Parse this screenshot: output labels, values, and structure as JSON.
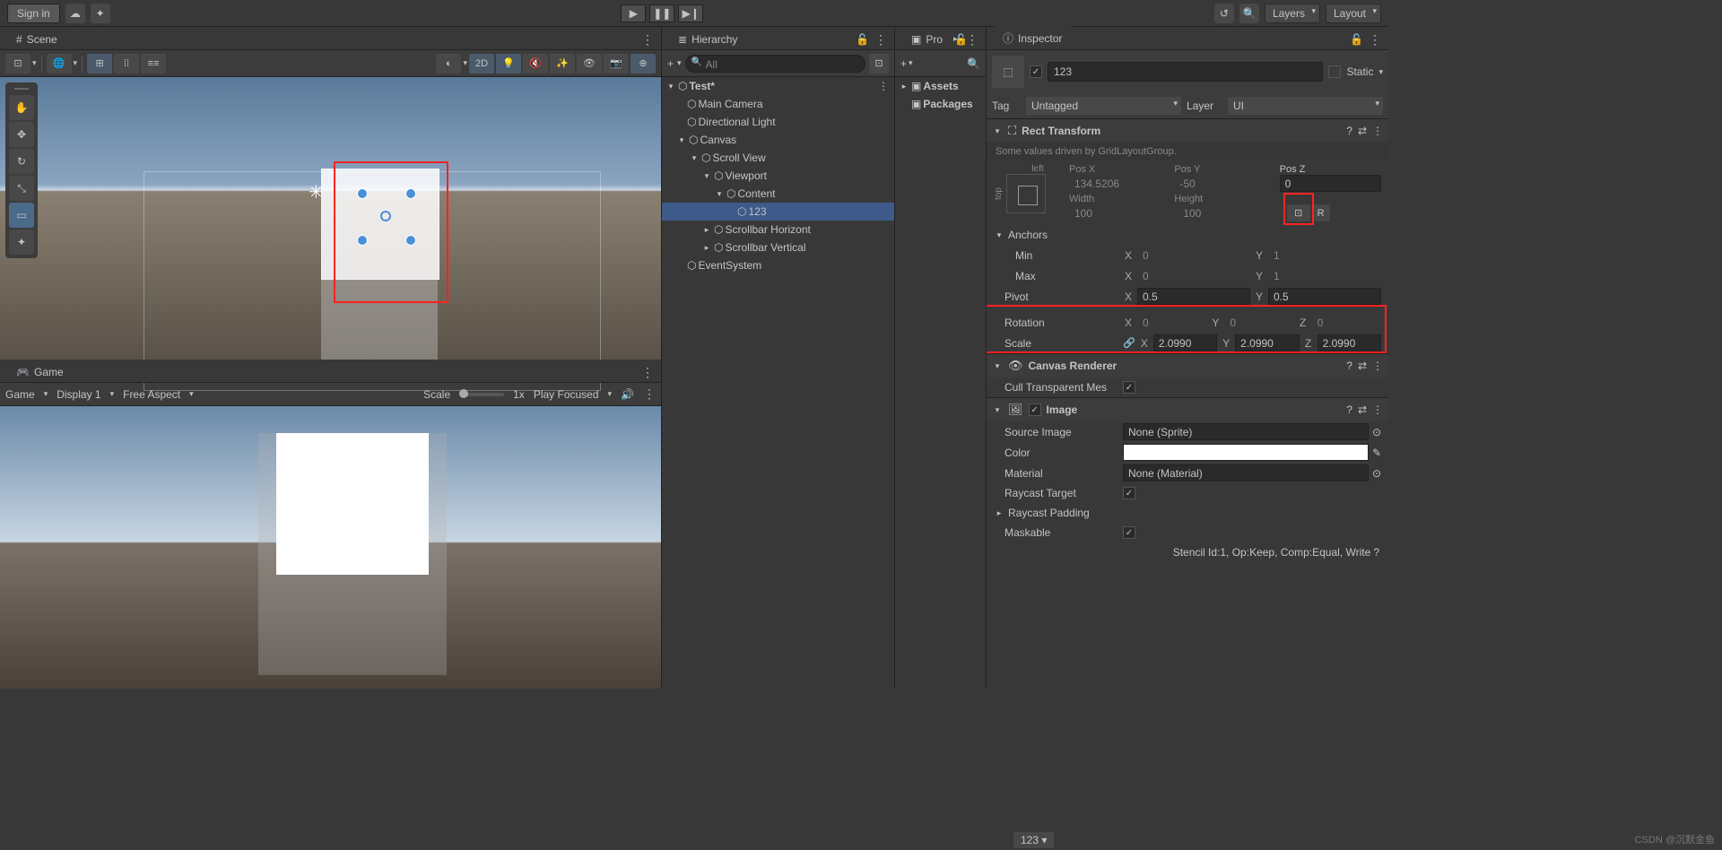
{
  "topbar": {
    "signin": "Sign in",
    "layers": "Layers",
    "layout": "Layout"
  },
  "tabs": {
    "scene": "Scene",
    "game": "Game",
    "hierarchy": "Hierarchy",
    "project": "Pro",
    "inspector": "Inspector"
  },
  "scene_toolbar": {
    "mode2d": "2D"
  },
  "game_bar": {
    "game": "Game",
    "display": "Display 1",
    "aspect": "Free Aspect",
    "scale_lbl": "Scale",
    "scale_val": "1x",
    "play_focused": "Play Focused"
  },
  "hierarchy": {
    "search_placeholder": "All",
    "root": "Test*",
    "items": [
      "Main Camera",
      "Directional Light",
      "Canvas",
      "Scroll View",
      "Viewport",
      "Content",
      "123",
      "Scrollbar Horizont",
      "Scrollbar Vertical",
      "EventSystem"
    ]
  },
  "project": {
    "assets": "Assets",
    "packages": "Packages"
  },
  "inspector": {
    "name": "123",
    "static": "Static",
    "tag_lbl": "Tag",
    "tag": "Untagged",
    "layer_lbl": "Layer",
    "layer": "UI",
    "rect": {
      "title": "Rect Transform",
      "driven": "Some values driven by GridLayoutGroup.",
      "anchor_h": "left",
      "anchor_v": "top",
      "posx_lbl": "Pos X",
      "posy_lbl": "Pos Y",
      "posz_lbl": "Pos Z",
      "posx": "134.5206",
      "posy": "-50",
      "posz": "0",
      "w_lbl": "Width",
      "h_lbl": "Height",
      "w": "100",
      "h": "100",
      "r_btn": "R",
      "anchors": "Anchors",
      "min": "Min",
      "max": "Max",
      "min_x": "0",
      "min_y": "1",
      "max_x": "0",
      "max_y": "1",
      "pivot": "Pivot",
      "pivot_x": "0.5",
      "pivot_y": "0.5",
      "rotation": "Rotation",
      "rot_x": "0",
      "rot_y": "0",
      "rot_z": "0",
      "scale": "Scale",
      "scl_x": "2.0990",
      "scl_y": "2.0990",
      "scl_z": "2.0990"
    },
    "canvas_renderer": {
      "title": "Canvas Renderer",
      "cull": "Cull Transparent Mes"
    },
    "image": {
      "title": "Image",
      "src_lbl": "Source Image",
      "src": "None (Sprite)",
      "color_lbl": "Color",
      "mat_lbl": "Material",
      "mat": "None (Material)",
      "raycast": "Raycast Target",
      "padding": "Raycast Padding",
      "maskable": "Maskable"
    },
    "stencil": "Stencil Id:1, Op:Keep, Comp:Equal, Write",
    "footer_obj": "123"
  },
  "watermark": "CSDN @沉默金鱼"
}
